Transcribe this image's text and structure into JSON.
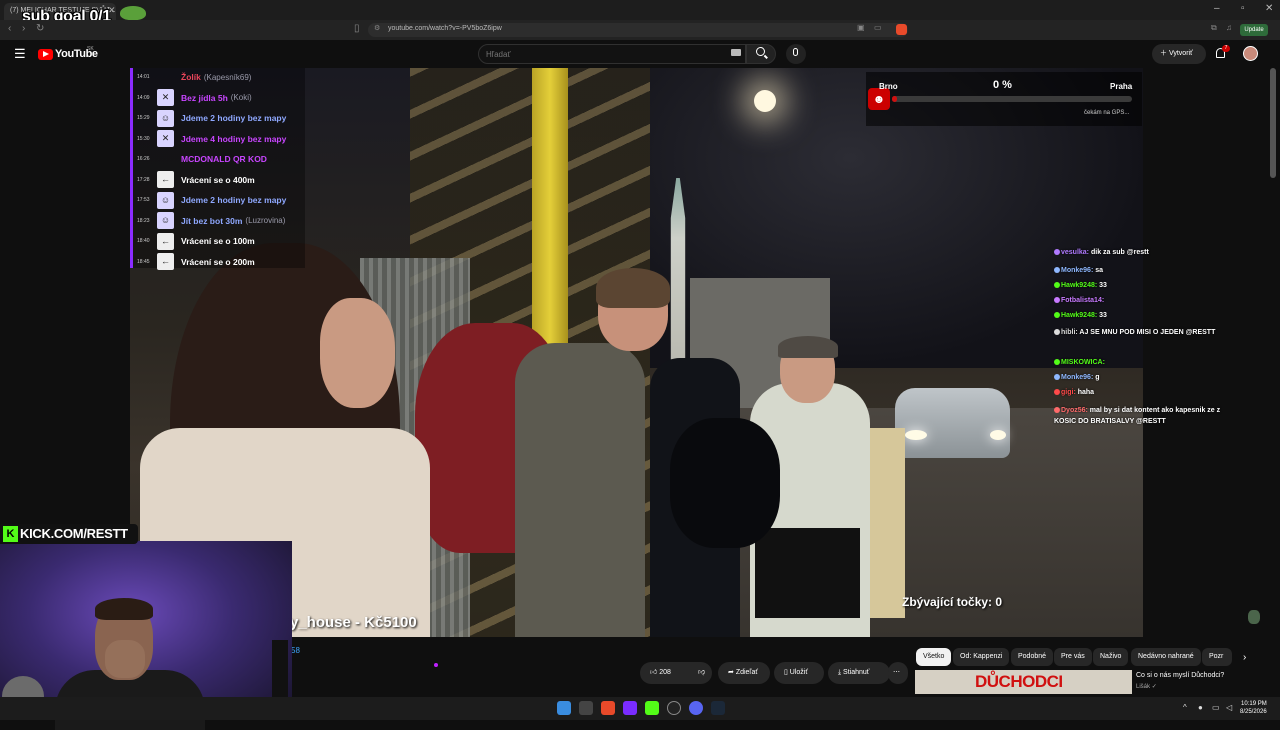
{
  "browser": {
    "tab_title": "(7) MELICHAR TESTUJE SVŮJ...",
    "url": "youtube.com/watch?v=-PV5boZ6ipw",
    "update_label": "Update"
  },
  "stream_overlay": {
    "sub_goal": "sub goal 0/1",
    "kick_url": "KICK.COM/RESTT",
    "donation": "y_house - Kč5100",
    "remaining_points": "Zbývající točky: 0"
  },
  "youtube": {
    "logo_text": "YouTube",
    "region": "SK",
    "search_placeholder": "Hľadať",
    "create_label": "Vytvoriť",
    "notification_count": "7",
    "views_fragment": "58"
  },
  "tasks": [
    {
      "time": "14:01",
      "icon": "",
      "label": "Žolík",
      "sub": "(Kapesník69)",
      "color": "#e8455a"
    },
    {
      "time": "14:09",
      "icon": "✕",
      "label": "Bez jídla 5h",
      "sub": "(Koki)",
      "color": "#c845ff"
    },
    {
      "time": "15:29",
      "icon": "☺",
      "label": "Jdeme 2 hodiny bez mapy",
      "sub": "",
      "color": "#8fa8ff"
    },
    {
      "time": "15:30",
      "icon": "✕",
      "label": "Jdeme 4 hodiny bez mapy",
      "sub": "",
      "color": "#c845ff"
    },
    {
      "time": "16:26",
      "icon": "",
      "label": "MCDONALD QR KOD",
      "sub": "",
      "color": "#c845ff"
    },
    {
      "time": "17:28",
      "icon": "←",
      "label": "Vrácení se o 400m",
      "sub": "",
      "color": "#ffffff"
    },
    {
      "time": "17:53",
      "icon": "☺",
      "label": "Jdeme 2 hodiny bez mapy",
      "sub": "",
      "color": "#8fa8ff"
    },
    {
      "time": "18:23",
      "icon": "☺",
      "label": "Jít bez bot 30m",
      "sub": "(Luzrovina)",
      "color": "#8fa8ff"
    },
    {
      "time": "18:40",
      "icon": "←",
      "label": "Vrácení se o 100m",
      "sub": "",
      "color": "#ffffff"
    },
    {
      "time": "18:45",
      "icon": "←",
      "label": "Vrácení se o 200m",
      "sub": "",
      "color": "#ffffff"
    }
  ],
  "gps": {
    "from": "Brno",
    "to": "Praha",
    "percent_label": "0 %",
    "progress": 0.02,
    "status": "čekám na GPS..."
  },
  "chat": [
    {
      "user": "vesulka:",
      "text": "dik za sub @restt",
      "color": "#b07aff"
    },
    {
      "user": "Monke96:",
      "text": "sa",
      "color": "#8fb8ff"
    },
    {
      "user": "Hawk9248:",
      "text": "33",
      "color": "#53fc18"
    },
    {
      "user": "Fotbalista14:",
      "text": "",
      "color": "#c87aff"
    },
    {
      "user": "Hawk9248:",
      "text": "33",
      "color": "#53fc18"
    },
    {
      "user": "hibli:",
      "text": "AJ SE MNU POD MISI O JEDEN @RESTT",
      "color": "#dddddd"
    },
    {
      "user": "MISKOWICA:",
      "text": "",
      "color": "#53fc18"
    },
    {
      "user": "Monke96:",
      "text": "g",
      "color": "#8fb8ff"
    },
    {
      "user": "gigi:",
      "text": "haha",
      "color": "#ff4a4a"
    },
    {
      "user": "Dyoz56:",
      "text": "mal by si dat kontent ako kapesnik ze z KOSIC DO BRATISALVY @RESTT",
      "color": "#ff6a6a"
    }
  ],
  "actions": {
    "likes": "208",
    "share": "Zdieľať",
    "save": "Uložiť",
    "download": "Stiahnuť"
  },
  "chips": [
    {
      "label": "Všetko",
      "active": true
    },
    {
      "label": "Od: Kappenzi",
      "active": false
    },
    {
      "label": "Podobné",
      "active": false
    },
    {
      "label": "Pre vás",
      "active": false
    },
    {
      "label": "Naživo",
      "active": false
    },
    {
      "label": "Nedávno nahrané",
      "active": false
    },
    {
      "label": "Pozr",
      "active": false
    }
  ],
  "recommendation": {
    "thumb_text": "DŮCHODCI",
    "title": "Co si o nás myslí Důchodci?",
    "channel": "Lišák"
  },
  "taskbar": {
    "time": "10:19 PM",
    "date": "8/25/2026"
  }
}
